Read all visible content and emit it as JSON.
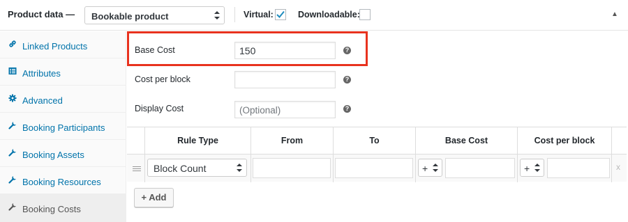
{
  "header": {
    "title": "Product data —",
    "product_type": "Bookable product",
    "virtual_label": "Virtual:",
    "virtual_checked": true,
    "downloadable_label": "Downloadable:",
    "downloadable_checked": false
  },
  "sidebar": {
    "items": [
      {
        "label": "Linked Products",
        "icon": "link-icon",
        "active": false
      },
      {
        "label": "Attributes",
        "icon": "list-icon",
        "active": false
      },
      {
        "label": "Advanced",
        "icon": "gear-icon",
        "active": false
      },
      {
        "label": "Booking Participants",
        "icon": "wrench-icon",
        "active": false
      },
      {
        "label": "Booking Assets",
        "icon": "wrench-icon",
        "active": false
      },
      {
        "label": "Booking Resources",
        "icon": "wrench-icon",
        "active": false
      },
      {
        "label": "Booking Costs",
        "icon": "wrench-icon",
        "active": true
      }
    ]
  },
  "form": {
    "base_cost": {
      "label": "Base Cost",
      "value": "150"
    },
    "cost_per_block": {
      "label": "Cost per block",
      "value": ""
    },
    "display_cost": {
      "label": "Display Cost",
      "value": "",
      "placeholder": "(Optional)"
    }
  },
  "table": {
    "headers": [
      "Rule Type",
      "From",
      "To",
      "Base Cost",
      "Cost per block"
    ],
    "rows": [
      {
        "rule_type": "Block Count",
        "base_cost_modifier": "+",
        "cost_per_block_modifier": "+",
        "remove": "x"
      }
    ]
  },
  "add_button": "+ Add",
  "colors": {
    "accent": "#0073aa",
    "highlight": "#e8321e",
    "checkmark": "#1e8cbe"
  }
}
